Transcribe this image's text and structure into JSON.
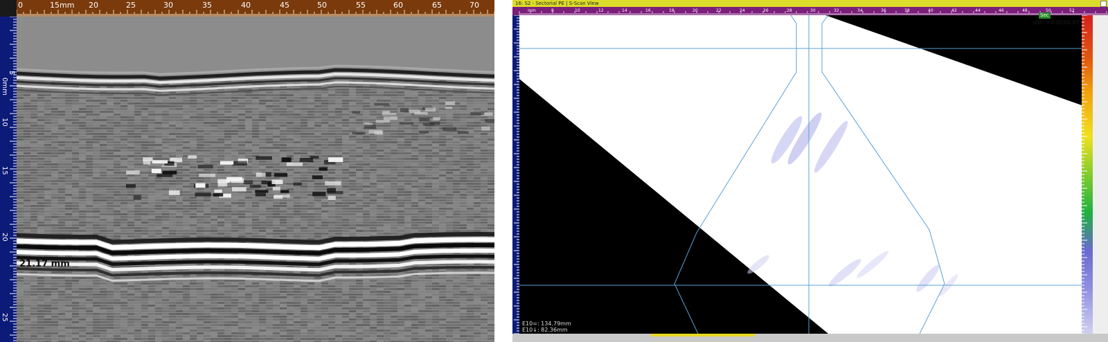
{
  "left_view": {
    "h_ruler": {
      "unit": "mm",
      "labels": [
        "0",
        "15mm",
        "20",
        "25",
        "30",
        "35",
        "40",
        "45",
        "50",
        "55",
        "60",
        "65",
        "70"
      ]
    },
    "v_ruler": {
      "labels": [
        "5",
        "0mm",
        "10",
        "15",
        "20",
        "25"
      ]
    },
    "depth_readout": "21.17 mm",
    "colors": {
      "top_ruler": "#7a3a0c",
      "side_ruler": "#0c1a78",
      "background": "#8a8a8a"
    }
  },
  "right_view": {
    "title": "16: S2 - Sectorial PE | S-Scan View",
    "h_ruler_labels": [
      "mm",
      "8",
      "10",
      "12",
      "14",
      "16",
      "18",
      "20",
      "22",
      "24",
      "26",
      "28",
      "30",
      "32",
      "34",
      "36",
      "38",
      "40",
      "42",
      "44",
      "46",
      "48",
      "50",
      "52"
    ],
    "gain_tag": "Sec",
    "gain_text": "dB: +6.0(20.0)%",
    "cursor_readouts": [
      "E10=: 134.79mm",
      "E10↓: 82.36mm"
    ],
    "colors": {
      "title_bar": "#dcdc2a",
      "top_ruler": "#7a1f7a",
      "side_ruler": "#0c1a78",
      "grid_line": "#5aa0d8"
    }
  }
}
